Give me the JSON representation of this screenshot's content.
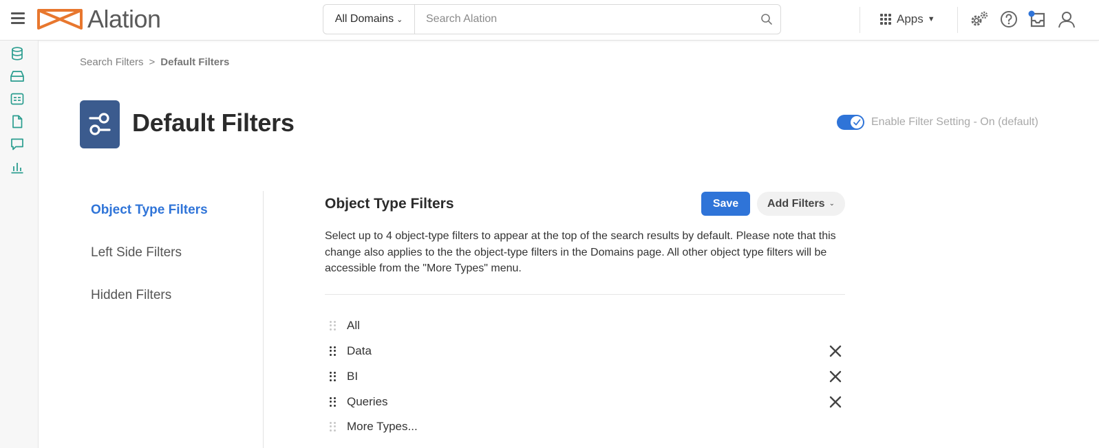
{
  "header": {
    "logo_text": "Alation",
    "domain_select": "All Domains",
    "search_placeholder": "Search Alation",
    "apps_label": "Apps",
    "icons": [
      "hamburger-icon",
      "search-icon",
      "apps-grid-icon",
      "settings-gears-icon",
      "help-icon",
      "inbox-icon",
      "user-icon"
    ],
    "brand_color": "#e8772e"
  },
  "rail": {
    "icons": [
      "database-icon",
      "storage-drive-icon",
      "catalog-list-icon",
      "document-icon",
      "conversation-icon",
      "bar-chart-icon"
    ],
    "icon_color": "#2a9d8f"
  },
  "breadcrumb": {
    "parent": "Search Filters",
    "separator": ">",
    "current": "Default Filters"
  },
  "page": {
    "title": "Default Filters",
    "toggle_label": "Enable Filter Setting - On (default)",
    "toggle_on": true,
    "accent_color": "#2f74d8"
  },
  "nav": {
    "items": [
      {
        "label": "Object Type Filters",
        "active": true
      },
      {
        "label": "Left Side Filters",
        "active": false
      },
      {
        "label": "Hidden Filters",
        "active": false
      }
    ]
  },
  "section": {
    "title": "Object Type Filters",
    "save_label": "Save",
    "add_filters_label": "Add Filters",
    "description": "Select up to 4 object-type filters to appear at the top of the search results by default. Please note that this change also applies to the the object-type filters in the Domains page. All other object type filters will be accessible from the \"More Types\" menu."
  },
  "filters": [
    {
      "label": "All",
      "removable": false
    },
    {
      "label": "Data",
      "removable": true
    },
    {
      "label": "BI",
      "removable": true
    },
    {
      "label": "Queries",
      "removable": true
    },
    {
      "label": "More Types...",
      "removable": false
    }
  ]
}
